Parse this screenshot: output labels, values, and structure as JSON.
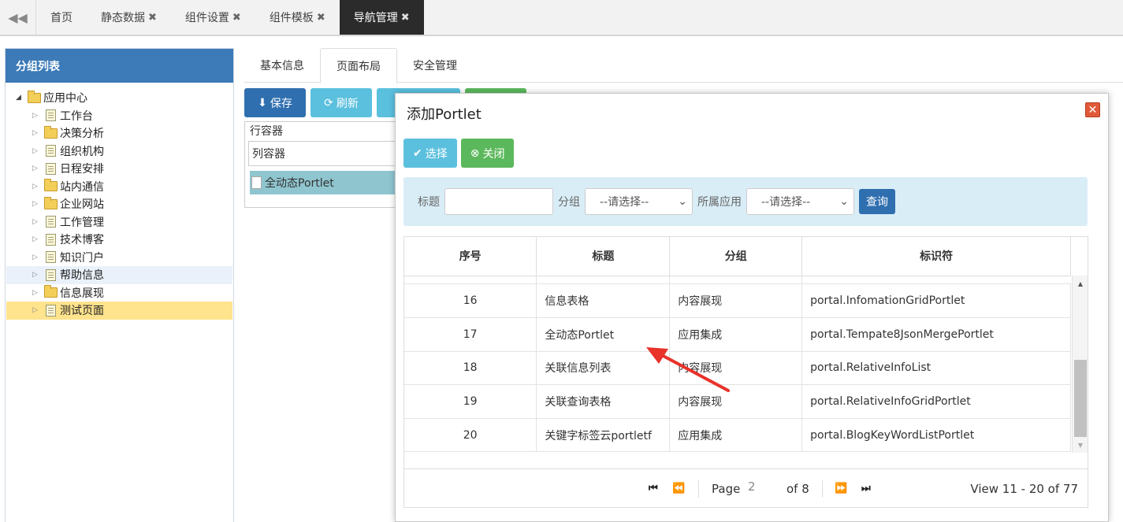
{
  "top_tabs": {
    "back_icon": "double-left-arrow-icon",
    "items": [
      {
        "label": "首页",
        "closable": false,
        "active": false
      },
      {
        "label": "静态数据",
        "closable": true,
        "active": false
      },
      {
        "label": "组件设置",
        "closable": true,
        "active": false
      },
      {
        "label": "组件模板",
        "closable": true,
        "active": false
      },
      {
        "label": "导航管理",
        "closable": true,
        "active": true
      }
    ],
    "close_glyph": "✖"
  },
  "left_panel": {
    "title": "分组列表",
    "root": "应用中心",
    "items": [
      {
        "label": "工作台",
        "icon": "doc"
      },
      {
        "label": "决策分析",
        "icon": "folder"
      },
      {
        "label": "组织机构",
        "icon": "doc"
      },
      {
        "label": "日程安排",
        "icon": "doc"
      },
      {
        "label": "站内通信",
        "icon": "folder"
      },
      {
        "label": "企业网站",
        "icon": "folder"
      },
      {
        "label": "工作管理",
        "icon": "doc"
      },
      {
        "label": "技术博客",
        "icon": "doc"
      },
      {
        "label": "知识门户",
        "icon": "doc"
      },
      {
        "label": "帮助信息",
        "icon": "doc"
      },
      {
        "label": "信息展现",
        "icon": "folder"
      },
      {
        "label": "测试页面",
        "icon": "doc"
      }
    ],
    "hovered": "帮助信息",
    "selected": "测试页面"
  },
  "right_tabs": [
    {
      "label": "基本信息",
      "active": false
    },
    {
      "label": "页面布局",
      "active": true
    },
    {
      "label": "安全管理",
      "active": false
    }
  ],
  "toolbar": {
    "save_label": "保存",
    "refresh_label": "刷新"
  },
  "layout_box": {
    "row_container": "行容器",
    "col_container": "列容器",
    "portlet": "全动态Portlet"
  },
  "dialog": {
    "title": "添加Portlet",
    "select_label": "选择",
    "close_label": "关闭",
    "search": {
      "title_label": "标题",
      "group_label": "分组",
      "group_value": "--请选择--",
      "app_label": "所属应用",
      "app_value": "--请选择--",
      "query_label": "查询"
    },
    "grid": {
      "columns": [
        "序号",
        "标题",
        "分组",
        "标识符"
      ],
      "rows": [
        [
          "16",
          "信息表格",
          "内容展现",
          "portal.InfomationGridPortlet"
        ],
        [
          "17",
          "全动态Portlet",
          "应用集成",
          "portal.Tempate8JsonMergePortlet"
        ],
        [
          "18",
          "关联信息列表",
          "内容展现",
          "portal.RelativeInfoList"
        ],
        [
          "19",
          "关联查询表格",
          "内容展现",
          "portal.RelativeInfoGridPortlet"
        ],
        [
          "20",
          "关键字标签云portletf",
          "应用集成",
          "portal.BlogKeyWordListPortlet"
        ]
      ]
    },
    "pager": {
      "page_label": "Page",
      "page_value": "2",
      "of_label": "of 8",
      "view_label": "View 11 - 20 of 77"
    }
  },
  "colors": {
    "header_blue": "#3c7ab8",
    "save_blue": "#2f6fb0",
    "light_blue": "#5bc0de",
    "green": "#5cb85c",
    "selected_yellow": "#ffe38d",
    "arrow_red": "#e8322a"
  }
}
